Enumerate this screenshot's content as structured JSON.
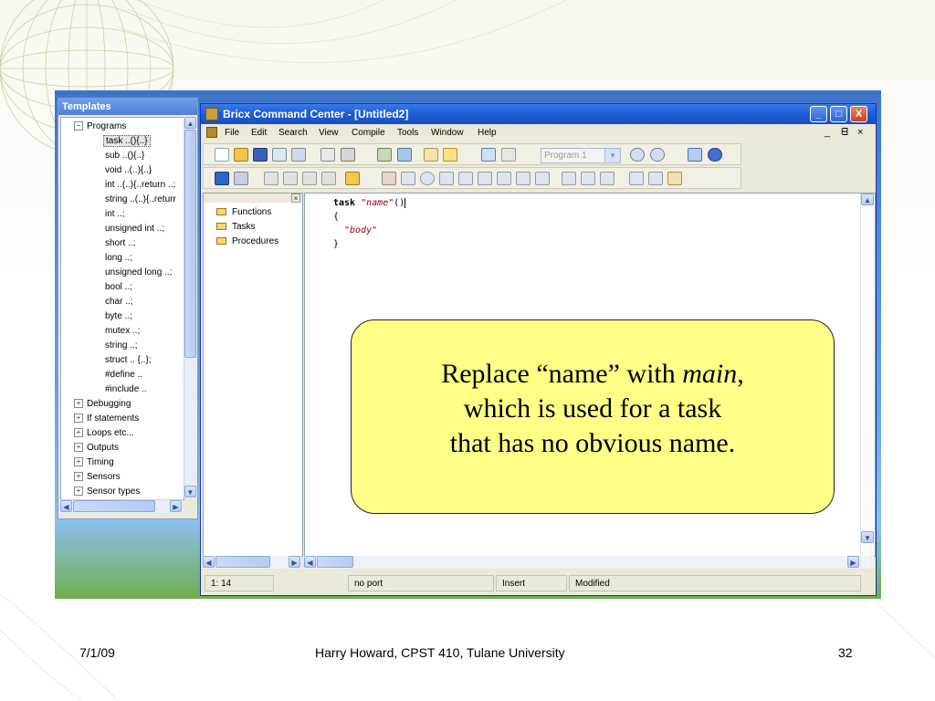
{
  "templates": {
    "title": "Templates",
    "tree": [
      {
        "label": "Programs",
        "toggle": "−",
        "level": 0
      },
      {
        "label": "task ..(){..}",
        "level": 1,
        "selected": true
      },
      {
        "label": "sub ..(){..}",
        "level": 1
      },
      {
        "label": "void ..(..){..}",
        "level": 1
      },
      {
        "label": "int ..(..){..return ..;",
        "level": 1
      },
      {
        "label": "string ..(..){..returr",
        "level": 1
      },
      {
        "label": "int ..;",
        "level": 1
      },
      {
        "label": "unsigned int ..;",
        "level": 1
      },
      {
        "label": "short ..;",
        "level": 1
      },
      {
        "label": "long ..;",
        "level": 1
      },
      {
        "label": "unsigned long ..;",
        "level": 1
      },
      {
        "label": "bool ..;",
        "level": 1
      },
      {
        "label": "char ..;",
        "level": 1
      },
      {
        "label": "byte ..;",
        "level": 1
      },
      {
        "label": "mutex ..;",
        "level": 1
      },
      {
        "label": "string ..;",
        "level": 1
      },
      {
        "label": "struct .. {..};",
        "level": 1
      },
      {
        "label": "#define ..",
        "level": 1
      },
      {
        "label": "#include ..",
        "level": 1
      },
      {
        "label": "Debugging",
        "toggle": "+",
        "level": 0
      },
      {
        "label": "If statements",
        "toggle": "+",
        "level": 0
      },
      {
        "label": "Loops etc...",
        "toggle": "+",
        "level": 0
      },
      {
        "label": "Outputs",
        "toggle": "+",
        "level": 0
      },
      {
        "label": "Timing",
        "toggle": "+",
        "level": 0
      },
      {
        "label": "Sensors",
        "toggle": "+",
        "level": 0
      },
      {
        "label": "Sensor types",
        "toggle": "+",
        "level": 0
      }
    ]
  },
  "window": {
    "title": "Bricx Command Center - [Untitled2]",
    "buttons": {
      "minimize": "_",
      "maximize": "□",
      "close": "X"
    },
    "menu": [
      "File",
      "Edit",
      "Search",
      "View",
      "Compile",
      "Tools",
      "Window",
      "Help"
    ],
    "mdi_controls": [
      "_",
      "ᗺ",
      "×"
    ],
    "program_select": "Program 1"
  },
  "explorer": {
    "items": [
      "Functions",
      "Tasks",
      "Procedures"
    ]
  },
  "editor": {
    "keyword": "task",
    "name_string": "\"name\"",
    "parens": "()",
    "open_brace": "{",
    "body_string": "\"body\"",
    "close_brace": "}"
  },
  "status": {
    "position": "1: 14",
    "port": "no port",
    "mode": "Insert",
    "state": "Modified"
  },
  "callout": {
    "part1": "Replace “name” with ",
    "emph": "main",
    "part2": ",",
    "line2": "which is used for a task",
    "line3": "that has no obvious name."
  },
  "footer": {
    "date": "7/1/09",
    "author": "Harry Howard, CPST 410, Tulane University",
    "page": "32"
  },
  "colors": {
    "titlebar": "#1e5fd6",
    "callout_fill": "#ffff88",
    "string_text": "#a00000"
  }
}
